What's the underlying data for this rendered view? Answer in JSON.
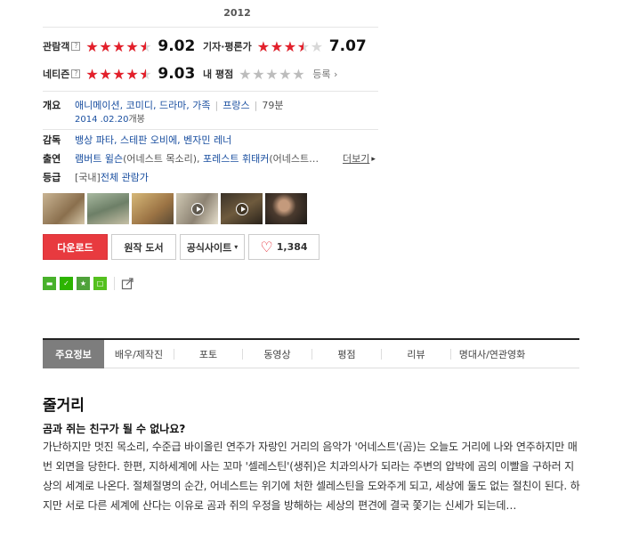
{
  "year": "2012",
  "ratings": {
    "audience": {
      "label": "관람객",
      "help": "?",
      "score": "9.02",
      "stars": 4.5
    },
    "critics": {
      "label": "기자·평론가",
      "score": "7.07",
      "stars": 3.5
    },
    "netizen": {
      "label": "네티즌",
      "help": "?",
      "score": "9.03",
      "stars": 4.5
    },
    "mine": {
      "label": "내 평점",
      "stars": 0,
      "register": "등록"
    }
  },
  "info": {
    "overview_label": "개요",
    "genres": "애니메이션, 코미디, 드라마, 가족",
    "country": "프랑스",
    "runtime": "79분",
    "release_date": "2014 .02.20",
    "release_suffix": "개봉",
    "director_label": "감독",
    "directors": "뱅상 파타, 스테판 오비에, 벤자민 레너",
    "cast_label": "출연",
    "cast1_name": "램버트 윌슨",
    "cast1_role": "(어네스트 목소리),",
    "cast2_name": "포레스트 휘태커",
    "cast2_role": "(어네스트…",
    "more": "더보기",
    "grade_label": "등급",
    "grade_region": "[국내]",
    "grade_value": "전체 관람가"
  },
  "buttons": {
    "download": "다운로드",
    "original": "원작 도서",
    "official": "공식사이트",
    "likes": "1,384"
  },
  "tabs": [
    "주요정보",
    "배우/제작진",
    "포토",
    "동영상",
    "평점",
    "리뷰",
    "명대사/연관영화"
  ],
  "synopsis": {
    "title": "줄거리",
    "subtitle": "곰과 쥐는 친구가 될 수 없나요?",
    "body": "가난하지만 멋진 목소리, 수준급 바이올린 연주가 자랑인 거리의 음악가 '어네스트'(곰)는 오늘도 거리에 나와 연주하지만 매번 외면을 당한다. 한편, 지하세계에 사는 꼬마 '셀레스틴'(생쥐)은 치과의사가 되라는 주변의 압박에 곰의 이빨을 구하러 지상의 세계로 나온다. 절체절명의 순간, 어네스트는 위기에 처한 셀레스틴을 도와주게 되고, 세상에 둘도 없는 절친이 된다. 하지만 서로 다른 세계에 산다는 이유로 곰과 쥐의 우정을 방해하는 세상의 편견에 결국 쫓기는 신세가 되는데…"
  },
  "colors": {
    "accent_red": "#e83a3f",
    "link": "#1a4fa0",
    "tab_active": "#7d7d7d"
  },
  "icons": [
    "help-icon",
    "star-icon",
    "play-icon",
    "heart-icon",
    "chevron-down-icon",
    "chevron-right-icon",
    "share-icon"
  ]
}
